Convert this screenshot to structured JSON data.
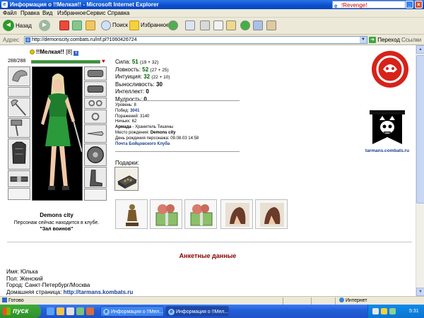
{
  "window": {
    "title": "Информация о !!Мелкая!! - Microsoft Internet Explorer",
    "other_window_title": "!Revenge!"
  },
  "menu": [
    "Файл",
    "Правка",
    "Вид",
    "Избранное",
    "Сервис",
    "Справка"
  ],
  "toolbar": {
    "back_label": "Назад",
    "search_label": "Поиск",
    "favorites_label": "Избранное"
  },
  "address": {
    "label": "Адрес",
    "url": "http://demonscity.combats.ru/inf.pl?1060426724",
    "go_label": "Переход",
    "links_label": "Ссылки"
  },
  "character": {
    "name": "!!Мелкая!!",
    "level": "[8]",
    "info_badge": "i",
    "hp_text": "288/288",
    "hp_fraction": 1.0,
    "location_city": "Demons city",
    "club_note": "Персонаж сейчас находится в клубе.",
    "room": "\"Зал воинов\""
  },
  "stats": [
    {
      "label": "Сила:",
      "value": "51",
      "extra": "(19 + 32)"
    },
    {
      "label": "Ловкость:",
      "value": "52",
      "extra": "(27 + 25)"
    },
    {
      "label": "Интуиция:",
      "value": "32",
      "extra": "(22 + 10)"
    },
    {
      "label": "Выносливость:",
      "value": "30",
      "extra": ""
    },
    {
      "label": "Интеллект:",
      "value": "0",
      "extra": ""
    },
    {
      "label": "Мудрость:",
      "value": "0",
      "extra": ""
    }
  ],
  "bio": {
    "level_label": "Уровень:",
    "level": "8",
    "wins_label": "Побед:",
    "wins": "3041",
    "losses_label": "Поражений:",
    "losses": "3140",
    "draws_label": "Ничьих:",
    "draws": "62",
    "armada_label": "Армада",
    "armada_value": " - Хранитель Тишины",
    "birthplace_label": "Место рождения:",
    "birthplace": "Demons city",
    "birthday_label": "День рождения персонажа:",
    "birthday": "09.08.03 14:58",
    "mail_link": "Почта Бойцовского Клуба"
  },
  "gifts": {
    "label": "Подарки:"
  },
  "clan": {
    "url": "tarmans.combats.ru"
  },
  "profile": {
    "section_title": "Анкетные данные",
    "name_line": "Имя: Юлька",
    "sex_line": "Пол: Женский",
    "city_line": "Город: Санкт-Петербург/Москва",
    "homepage_label": "Домашняя страница: ",
    "homepage": "http://tarmans.kombats.ru"
  },
  "statusbar": {
    "status": "Готово",
    "zone": "Интернет"
  },
  "taskbar": {
    "start_label": "пуск",
    "tasks": [
      "Информация о !!Мел...",
      "Информация о !!Мел..."
    ],
    "clock": "5:31"
  },
  "colors": {
    "accent": "#0a4fcf",
    "stat_value": "#006400",
    "section_title": "#8b0000",
    "link": "#183e8f",
    "hp_fill": "#1fa31f"
  }
}
